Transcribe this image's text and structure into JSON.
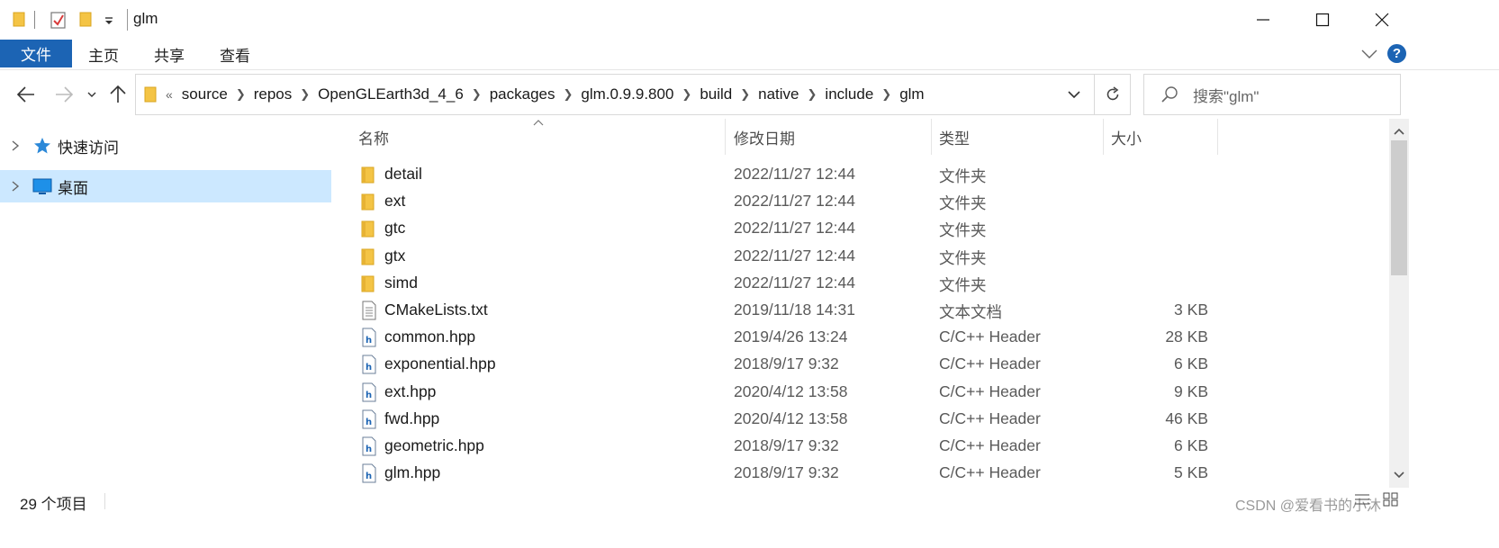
{
  "window": {
    "title": "glm"
  },
  "ribbon": {
    "tabs": [
      {
        "label": "文件",
        "active": true
      },
      {
        "label": "主页"
      },
      {
        "label": "共享"
      },
      {
        "label": "查看"
      }
    ],
    "help_label": "?"
  },
  "address": {
    "overflow_label": "«",
    "segments": [
      "source",
      "repos",
      "OpenGLEarth3d_4_6",
      "packages",
      "glm.0.9.9.800",
      "build",
      "native",
      "include",
      "glm"
    ]
  },
  "search": {
    "placeholder": "搜索\"glm\""
  },
  "nav_pane": {
    "items": [
      {
        "label": "快速访问",
        "icon": "star-icon",
        "selected": false
      },
      {
        "label": "桌面",
        "icon": "desktop-icon",
        "selected": true
      }
    ]
  },
  "columns": [
    "名称",
    "修改日期",
    "类型",
    "大小"
  ],
  "files": [
    {
      "name": "detail",
      "date": "2022/11/27 12:44",
      "type": "文件夹",
      "size": "",
      "icon": "folder-icon"
    },
    {
      "name": "ext",
      "date": "2022/11/27 12:44",
      "type": "文件夹",
      "size": "",
      "icon": "folder-icon"
    },
    {
      "name": "gtc",
      "date": "2022/11/27 12:44",
      "type": "文件夹",
      "size": "",
      "icon": "folder-icon"
    },
    {
      "name": "gtx",
      "date": "2022/11/27 12:44",
      "type": "文件夹",
      "size": "",
      "icon": "folder-icon"
    },
    {
      "name": "simd",
      "date": "2022/11/27 12:44",
      "type": "文件夹",
      "size": "",
      "icon": "folder-icon"
    },
    {
      "name": "CMakeLists.txt",
      "date": "2019/11/18 14:31",
      "type": "文本文档",
      "size": "3 KB",
      "icon": "text-file-icon"
    },
    {
      "name": "common.hpp",
      "date": "2019/4/26 13:24",
      "type": "C/C++ Header",
      "size": "28 KB",
      "icon": "header-file-icon"
    },
    {
      "name": "exponential.hpp",
      "date": "2018/9/17 9:32",
      "type": "C/C++ Header",
      "size": "6 KB",
      "icon": "header-file-icon"
    },
    {
      "name": "ext.hpp",
      "date": "2020/4/12 13:58",
      "type": "C/C++ Header",
      "size": "9 KB",
      "icon": "header-file-icon"
    },
    {
      "name": "fwd.hpp",
      "date": "2020/4/12 13:58",
      "type": "C/C++ Header",
      "size": "46 KB",
      "icon": "header-file-icon"
    },
    {
      "name": "geometric.hpp",
      "date": "2018/9/17 9:32",
      "type": "C/C++ Header",
      "size": "6 KB",
      "icon": "header-file-icon"
    },
    {
      "name": "glm.hpp",
      "date": "2018/9/17 9:32",
      "type": "C/C++ Header",
      "size": "5 KB",
      "icon": "header-file-icon"
    }
  ],
  "status": {
    "item_count": "29 个项目"
  },
  "watermark": "CSDN @爱看书的小沐",
  "colors": {
    "accent": "#1c64b4",
    "selection": "#cce8ff",
    "folder": "#f4c445"
  }
}
